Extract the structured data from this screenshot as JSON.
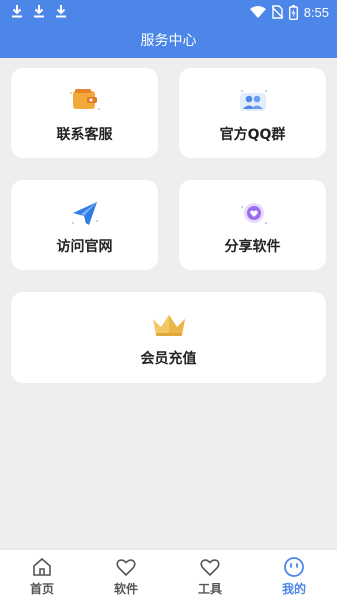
{
  "status": {
    "time": "8:55",
    "icons": [
      "download-icon",
      "download-icon",
      "download-icon",
      "wifi-icon",
      "no-sim-icon",
      "battery-icon"
    ]
  },
  "header": {
    "title": "服务中心"
  },
  "cards": [
    {
      "label": "联系客服",
      "icon": "wallet-icon"
    },
    {
      "label": "官方QQ群",
      "icon": "group-icon"
    },
    {
      "label": "访问官网",
      "icon": "paper-plane-icon"
    },
    {
      "label": "分享软件",
      "icon": "heart-badge-icon"
    },
    {
      "label": "会员充值",
      "icon": "crown-icon"
    }
  ],
  "tabs": [
    {
      "label": "首页",
      "icon": "home-icon"
    },
    {
      "label": "软件",
      "icon": "heart-icon"
    },
    {
      "label": "工具",
      "icon": "heart-icon"
    },
    {
      "label": "我的",
      "icon": "smiley-icon",
      "active": true
    }
  ],
  "colors": {
    "primary": "#4b86e8",
    "background": "#eeeeee",
    "card": "#ffffff"
  }
}
